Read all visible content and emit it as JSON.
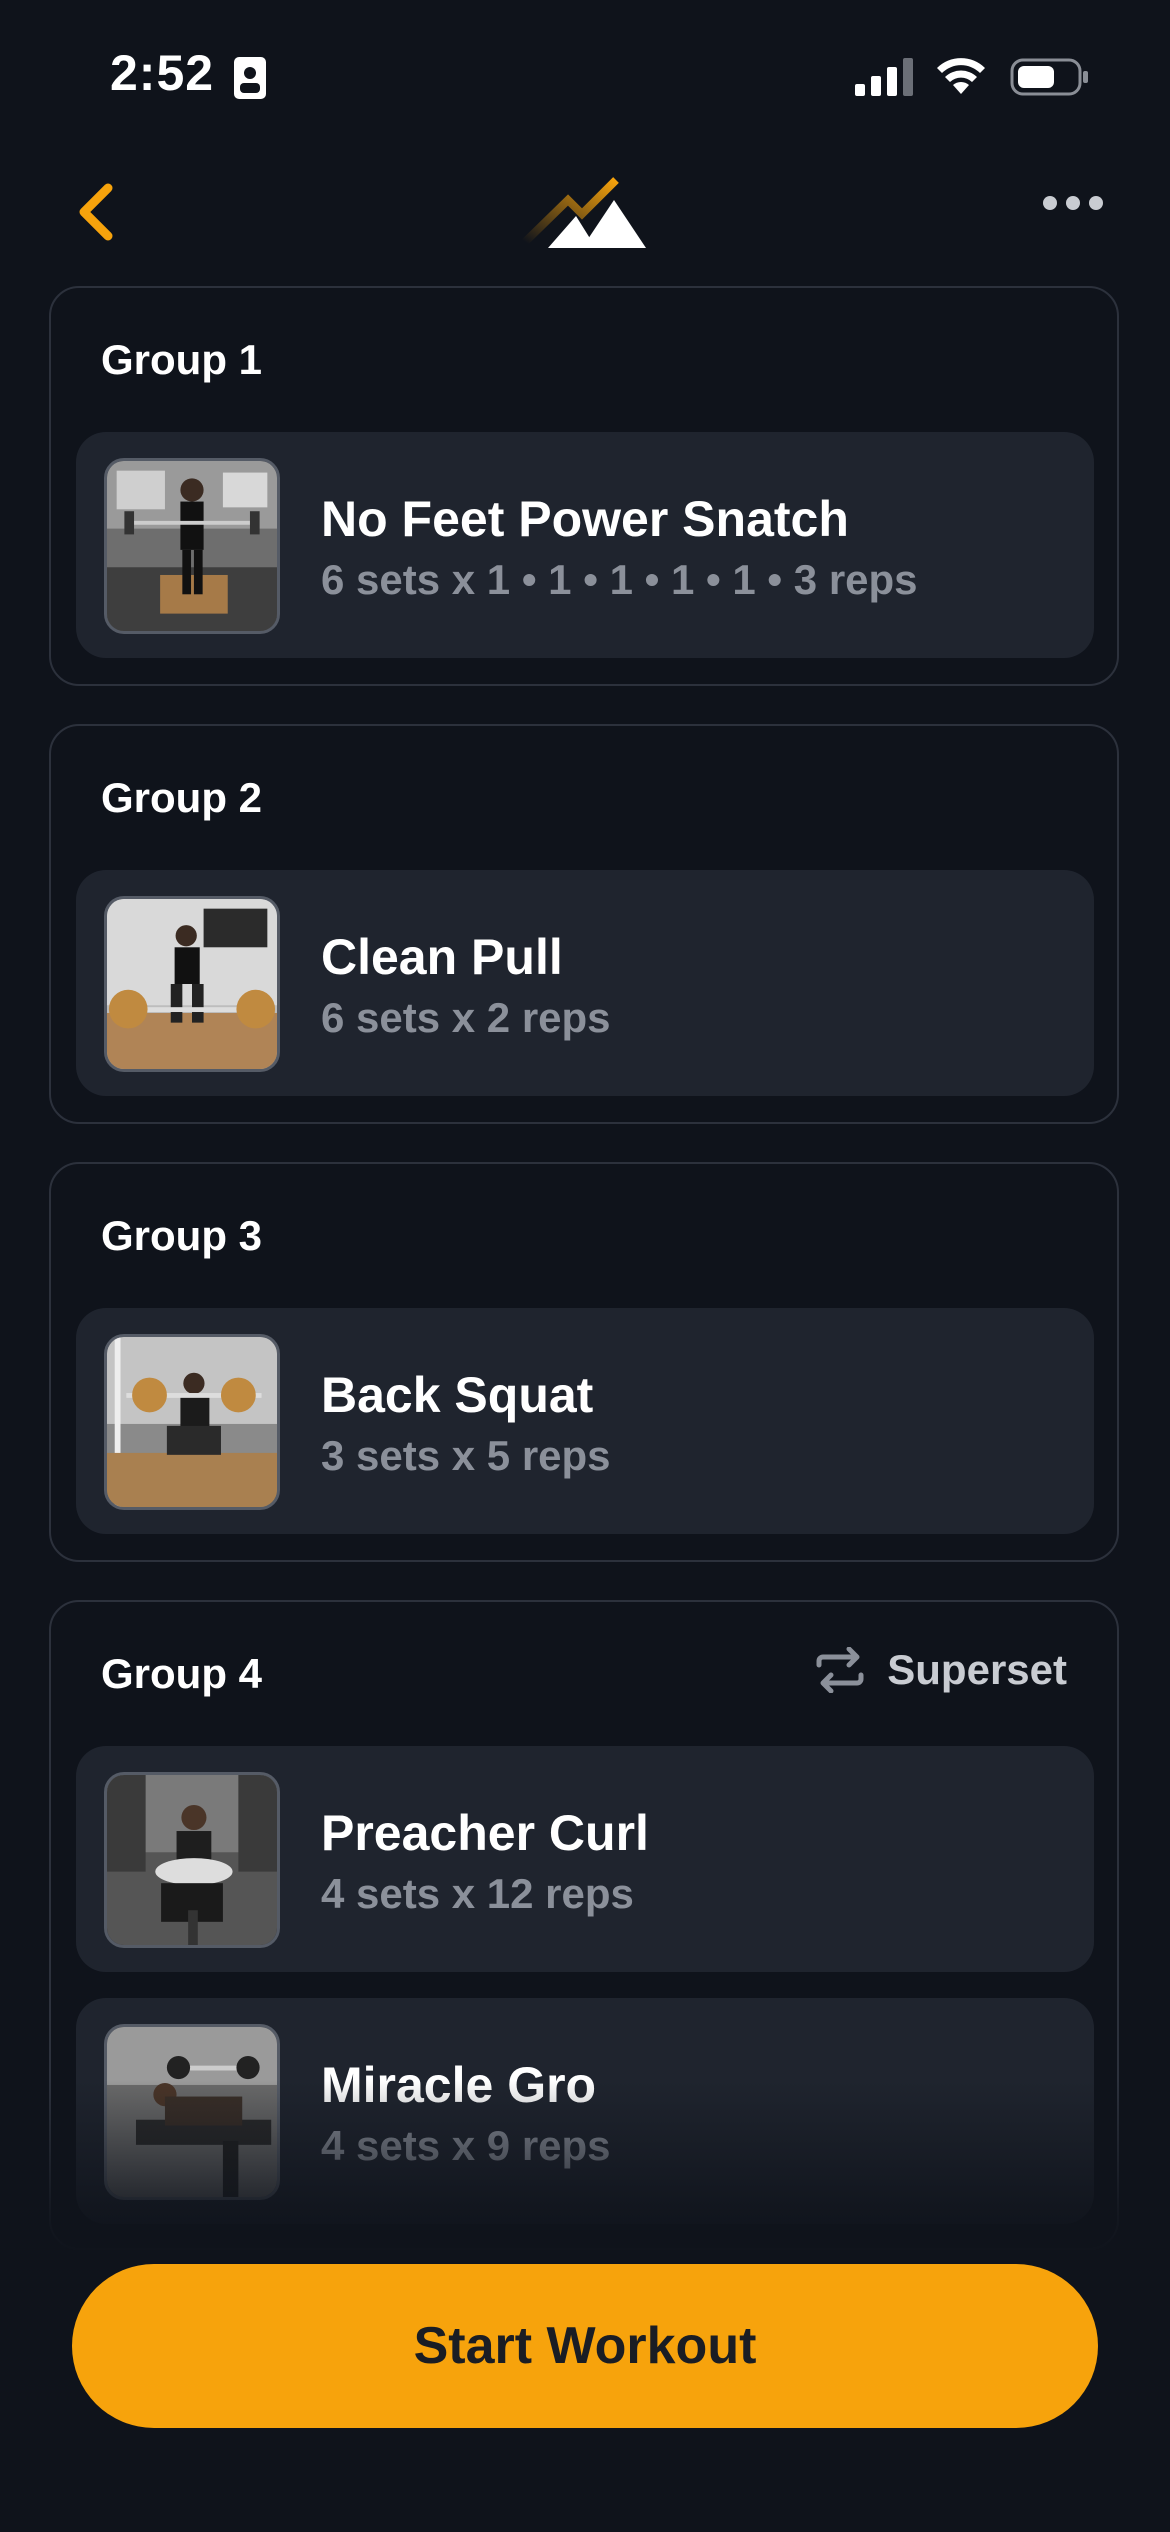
{
  "status_bar": {
    "time": "2:52"
  },
  "groups": [
    {
      "title": "Group 1",
      "superset": "",
      "exercises": [
        {
          "name": "No Feet Power Snatch",
          "sets": "6 sets x 1 • 1 • 1 • 1 • 1 • 3 reps"
        }
      ]
    },
    {
      "title": "Group 2",
      "superset": "",
      "exercises": [
        {
          "name": "Clean Pull",
          "sets": "6 sets x 2 reps"
        }
      ]
    },
    {
      "title": "Group 3",
      "superset": "",
      "exercises": [
        {
          "name": "Back Squat",
          "sets": "3 sets x 5 reps"
        }
      ]
    },
    {
      "title": "Group 4",
      "superset": "Superset",
      "exercises": [
        {
          "name": "Preacher Curl",
          "sets": "4 sets x 12 reps"
        },
        {
          "name": "Miracle Gro",
          "sets": "4 sets x 9 reps"
        }
      ]
    }
  ],
  "footer": {
    "start_label": "Start Workout"
  },
  "colors": {
    "accent": "#f7a30c",
    "background": "#0f131b",
    "card": "#1f242e"
  }
}
